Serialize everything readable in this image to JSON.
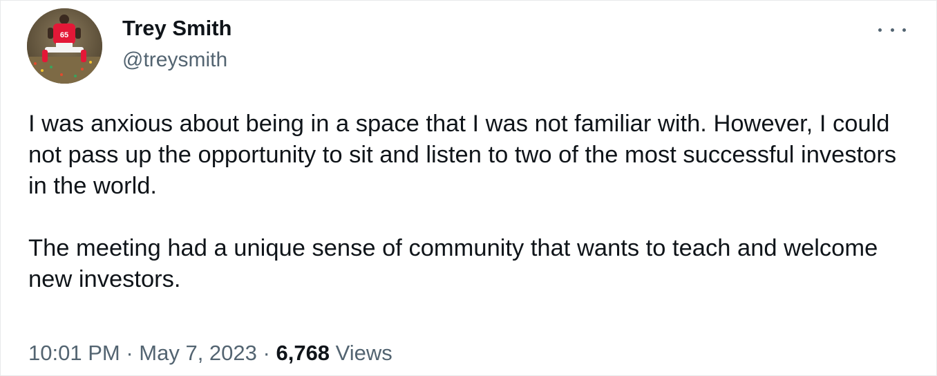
{
  "author": {
    "name": "Trey Smith",
    "handle": "@treysmith",
    "avatar_jersey_number": "65"
  },
  "more_icon": "more-horizontal-icon",
  "tweet": {
    "paragraphs": [
      "I was anxious about being in a space that I was not familiar with. However, I could not pass up the opportunity to sit and listen to two of the most successful investors in the world.",
      "The meeting had a unique sense of community that wants to teach and welcome new investors."
    ]
  },
  "meta": {
    "time": "10:01 PM",
    "separator": "·",
    "date": "May 7, 2023",
    "views_count": "6,768",
    "views_label": "Views"
  },
  "colors": {
    "text_primary": "#0f1419",
    "text_secondary": "#536471",
    "border": "#e7e9ea"
  }
}
